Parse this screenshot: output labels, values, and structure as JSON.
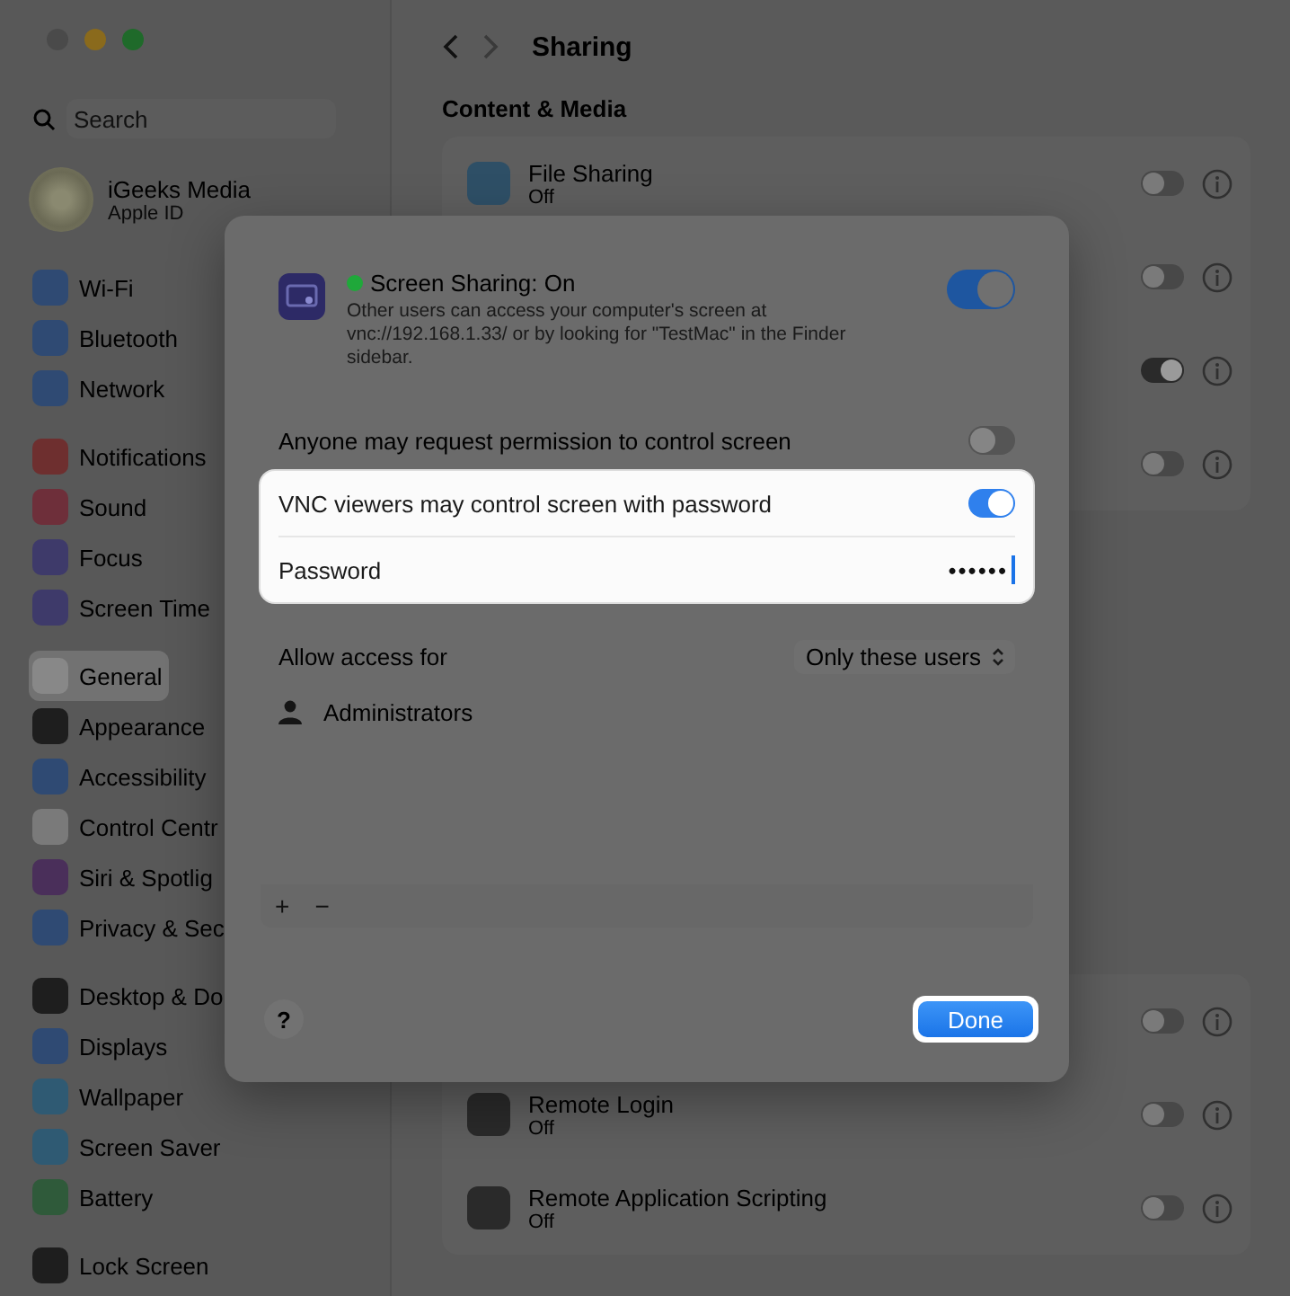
{
  "window": {
    "title": "Sharing"
  },
  "sidebar": {
    "search": {
      "placeholder": "Search"
    },
    "profile": {
      "name": "iGeeks Media",
      "subtitle": "Apple ID"
    },
    "groups": [
      {
        "items": [
          {
            "label": "Wi-Fi",
            "color": "#2f4a73",
            "selected": false
          },
          {
            "label": "Bluetooth",
            "color": "#2f4a73",
            "selected": false
          },
          {
            "label": "Network",
            "color": "#2f4a73",
            "selected": false
          }
        ]
      },
      {
        "items": [
          {
            "label": "Notifications",
            "color": "#6e2f2f",
            "selected": false
          },
          {
            "label": "Sound",
            "color": "#6e2f3a",
            "selected": false
          },
          {
            "label": "Focus",
            "color": "#3e3a6a",
            "selected": false
          },
          {
            "label": "Screen Time",
            "color": "#3e3a6a",
            "selected": false
          }
        ]
      },
      {
        "items": [
          {
            "label": "General",
            "color": "#888888",
            "selected": true
          },
          {
            "label": "Appearance",
            "color": "#1e1e1e",
            "selected": false
          },
          {
            "label": "Accessibility",
            "color": "#2f4a73",
            "selected": false
          },
          {
            "label": "Control Centr",
            "color": "#7a7a7a",
            "selected": false
          },
          {
            "label": "Siri & Spotlig",
            "color": "#4a2f5a",
            "selected": false
          },
          {
            "label": "Privacy & Sec",
            "color": "#2f4a73",
            "selected": false
          }
        ]
      },
      {
        "items": [
          {
            "label": "Desktop & Do",
            "color": "#1e1e1e",
            "selected": false
          },
          {
            "label": "Displays",
            "color": "#2f4a73",
            "selected": false
          },
          {
            "label": "Wallpaper",
            "color": "#2f5a73",
            "selected": false
          },
          {
            "label": "Screen Saver",
            "color": "#2f5a73",
            "selected": false
          },
          {
            "label": "Battery",
            "color": "#2f5a3a",
            "selected": false
          }
        ]
      },
      {
        "items": [
          {
            "label": "Lock Screen",
            "color": "#1e1e1e",
            "selected": false
          }
        ]
      }
    ]
  },
  "content": {
    "section": "Content & Media",
    "rows_top": [
      {
        "name": "File Sharing",
        "status": "Off",
        "on": false
      },
      {
        "on": false
      },
      {
        "on": true
      },
      {
        "on": false
      }
    ],
    "rows_bottom": [
      {
        "on": false
      },
      {
        "name": "Remote Login",
        "status": "Off",
        "on": false
      },
      {
        "name": "Remote Application Scripting",
        "status": "Off",
        "on": false
      }
    ]
  },
  "dialog": {
    "title": "Screen Sharing: On",
    "description": "Other users can access your computer's screen at vnc://192.168.1.33/ or by looking for \"TestMac\" in the Finder sidebar.",
    "on": true,
    "anyone_request": {
      "label": "Anyone may request permission to control screen",
      "on": false
    },
    "vnc": {
      "label": "VNC viewers may control screen with password",
      "on": true
    },
    "password": {
      "label": "Password",
      "value": "••••••"
    },
    "access": {
      "label": "Allow access for",
      "value": "Only these users"
    },
    "users": [
      "Administrators"
    ],
    "add": "+",
    "remove": "−",
    "help": "?",
    "done": "Done"
  }
}
